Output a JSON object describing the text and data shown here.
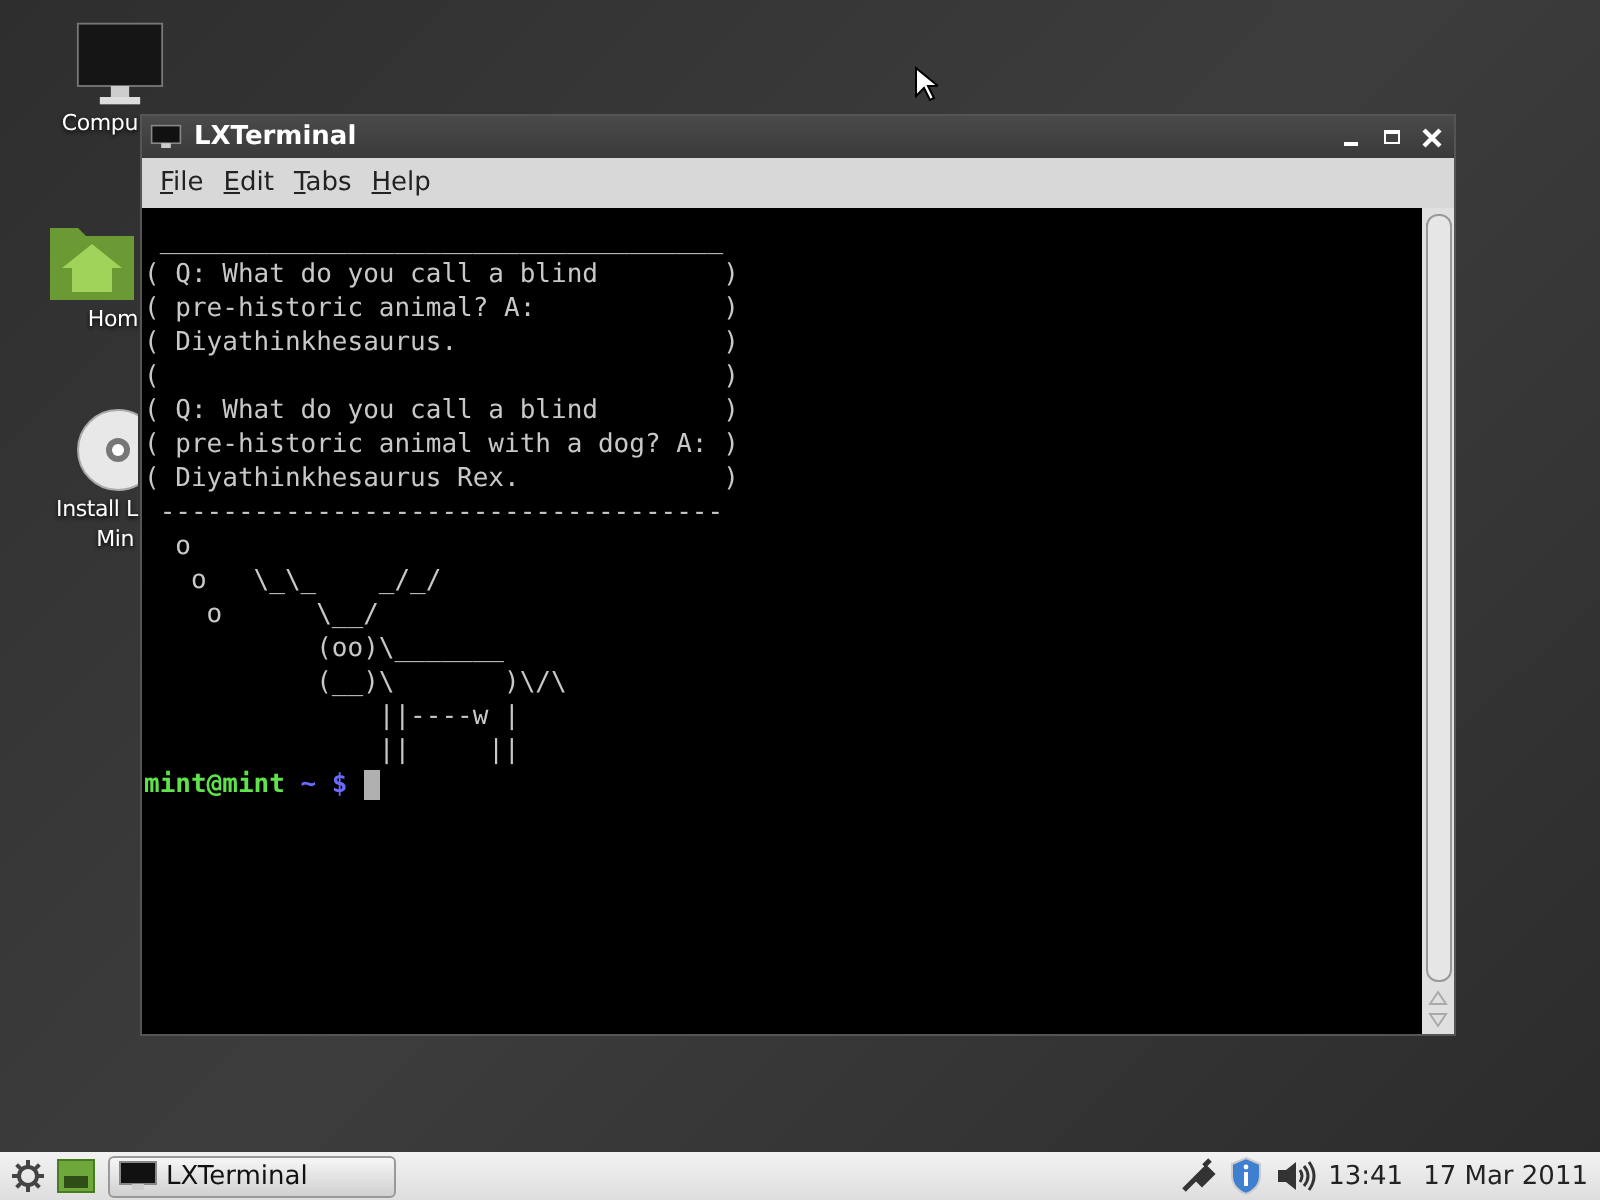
{
  "desktop_icons": [
    {
      "kind": "computer",
      "label": "Compu"
    },
    {
      "kind": "home",
      "label": "Hom"
    },
    {
      "kind": "disc",
      "label": "Install L",
      "label_2": "Min"
    }
  ],
  "window": {
    "title": "LXTerminal",
    "menu": [
      "File",
      "Edit",
      "Tabs",
      "Help"
    ],
    "terminal": {
      "lines": [
        " ____________________________________",
        "( Q: What do you call a blind        )",
        "( pre-historic animal? A:            )",
        "( Diyathinkhesaurus.                 )",
        "(                                    )",
        "( Q: What do you call a blind        )",
        "( pre-historic animal with a dog? A: )",
        "( Diyathinkhesaurus Rex.             )",
        " ------------------------------------",
        "  o",
        "   o   \\_\\_    _/_/",
        "    o      \\__/",
        "           (oo)\\_______",
        "           (__)\\       )\\/\\",
        "               ||----w |",
        "               ||     ||"
      ],
      "prompt": {
        "user_host": "mint@mint",
        "path": "~ $"
      }
    }
  },
  "taskbar": {
    "tasks": [
      {
        "label": "LXTerminal",
        "selected": false
      }
    ],
    "clock": "13:41",
    "date": "17 Mar 2011"
  }
}
